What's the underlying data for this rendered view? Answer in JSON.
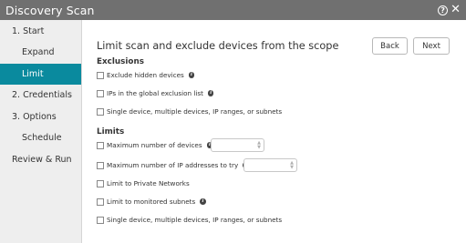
{
  "window": {
    "title": "Discovery Scan",
    "help_glyph": "?",
    "close_glyph": "✕"
  },
  "sidebar": {
    "items": [
      {
        "label": "1. Start",
        "level": "step",
        "active": false
      },
      {
        "label": "Expand",
        "level": "sub",
        "active": false
      },
      {
        "label": "Limit",
        "level": "sub",
        "active": true
      },
      {
        "label": "2. Credentials",
        "level": "step",
        "active": false
      },
      {
        "label": "3. Options",
        "level": "step",
        "active": false
      },
      {
        "label": "Schedule",
        "level": "sub",
        "active": false
      },
      {
        "label": "Review & Run",
        "level": "step",
        "active": false
      }
    ]
  },
  "main": {
    "heading": "Limit scan and exclude devices from the scope",
    "back_label": "Back",
    "next_label": "Next",
    "exclusions": {
      "title": "Exclusions",
      "options": [
        {
          "label": "Exclude hidden devices",
          "checked": false
        },
        {
          "label": "IPs in the global exclusion list",
          "checked": false
        },
        {
          "label": "Single device, multiple devices, IP ranges, or subnets",
          "checked": false
        }
      ]
    },
    "limits": {
      "title": "Limits",
      "options": [
        {
          "label": "Maximum number of devices",
          "checked": false
        },
        {
          "label": "Maximum number of IP addresses to try",
          "checked": false
        },
        {
          "label": "Limit to Private Networks",
          "checked": false
        },
        {
          "label": "Limit to monitored subnets",
          "checked": false
        },
        {
          "label": "Single device, multiple devices, IP ranges, or subnets",
          "checked": false
        }
      ]
    },
    "info_glyph": "i",
    "stepper_up": "▲",
    "stepper_down": "▼"
  },
  "colors": {
    "titlebar": "#707070",
    "sidebar_bg": "#eeeeee",
    "active_item": "#0a8a9e"
  }
}
